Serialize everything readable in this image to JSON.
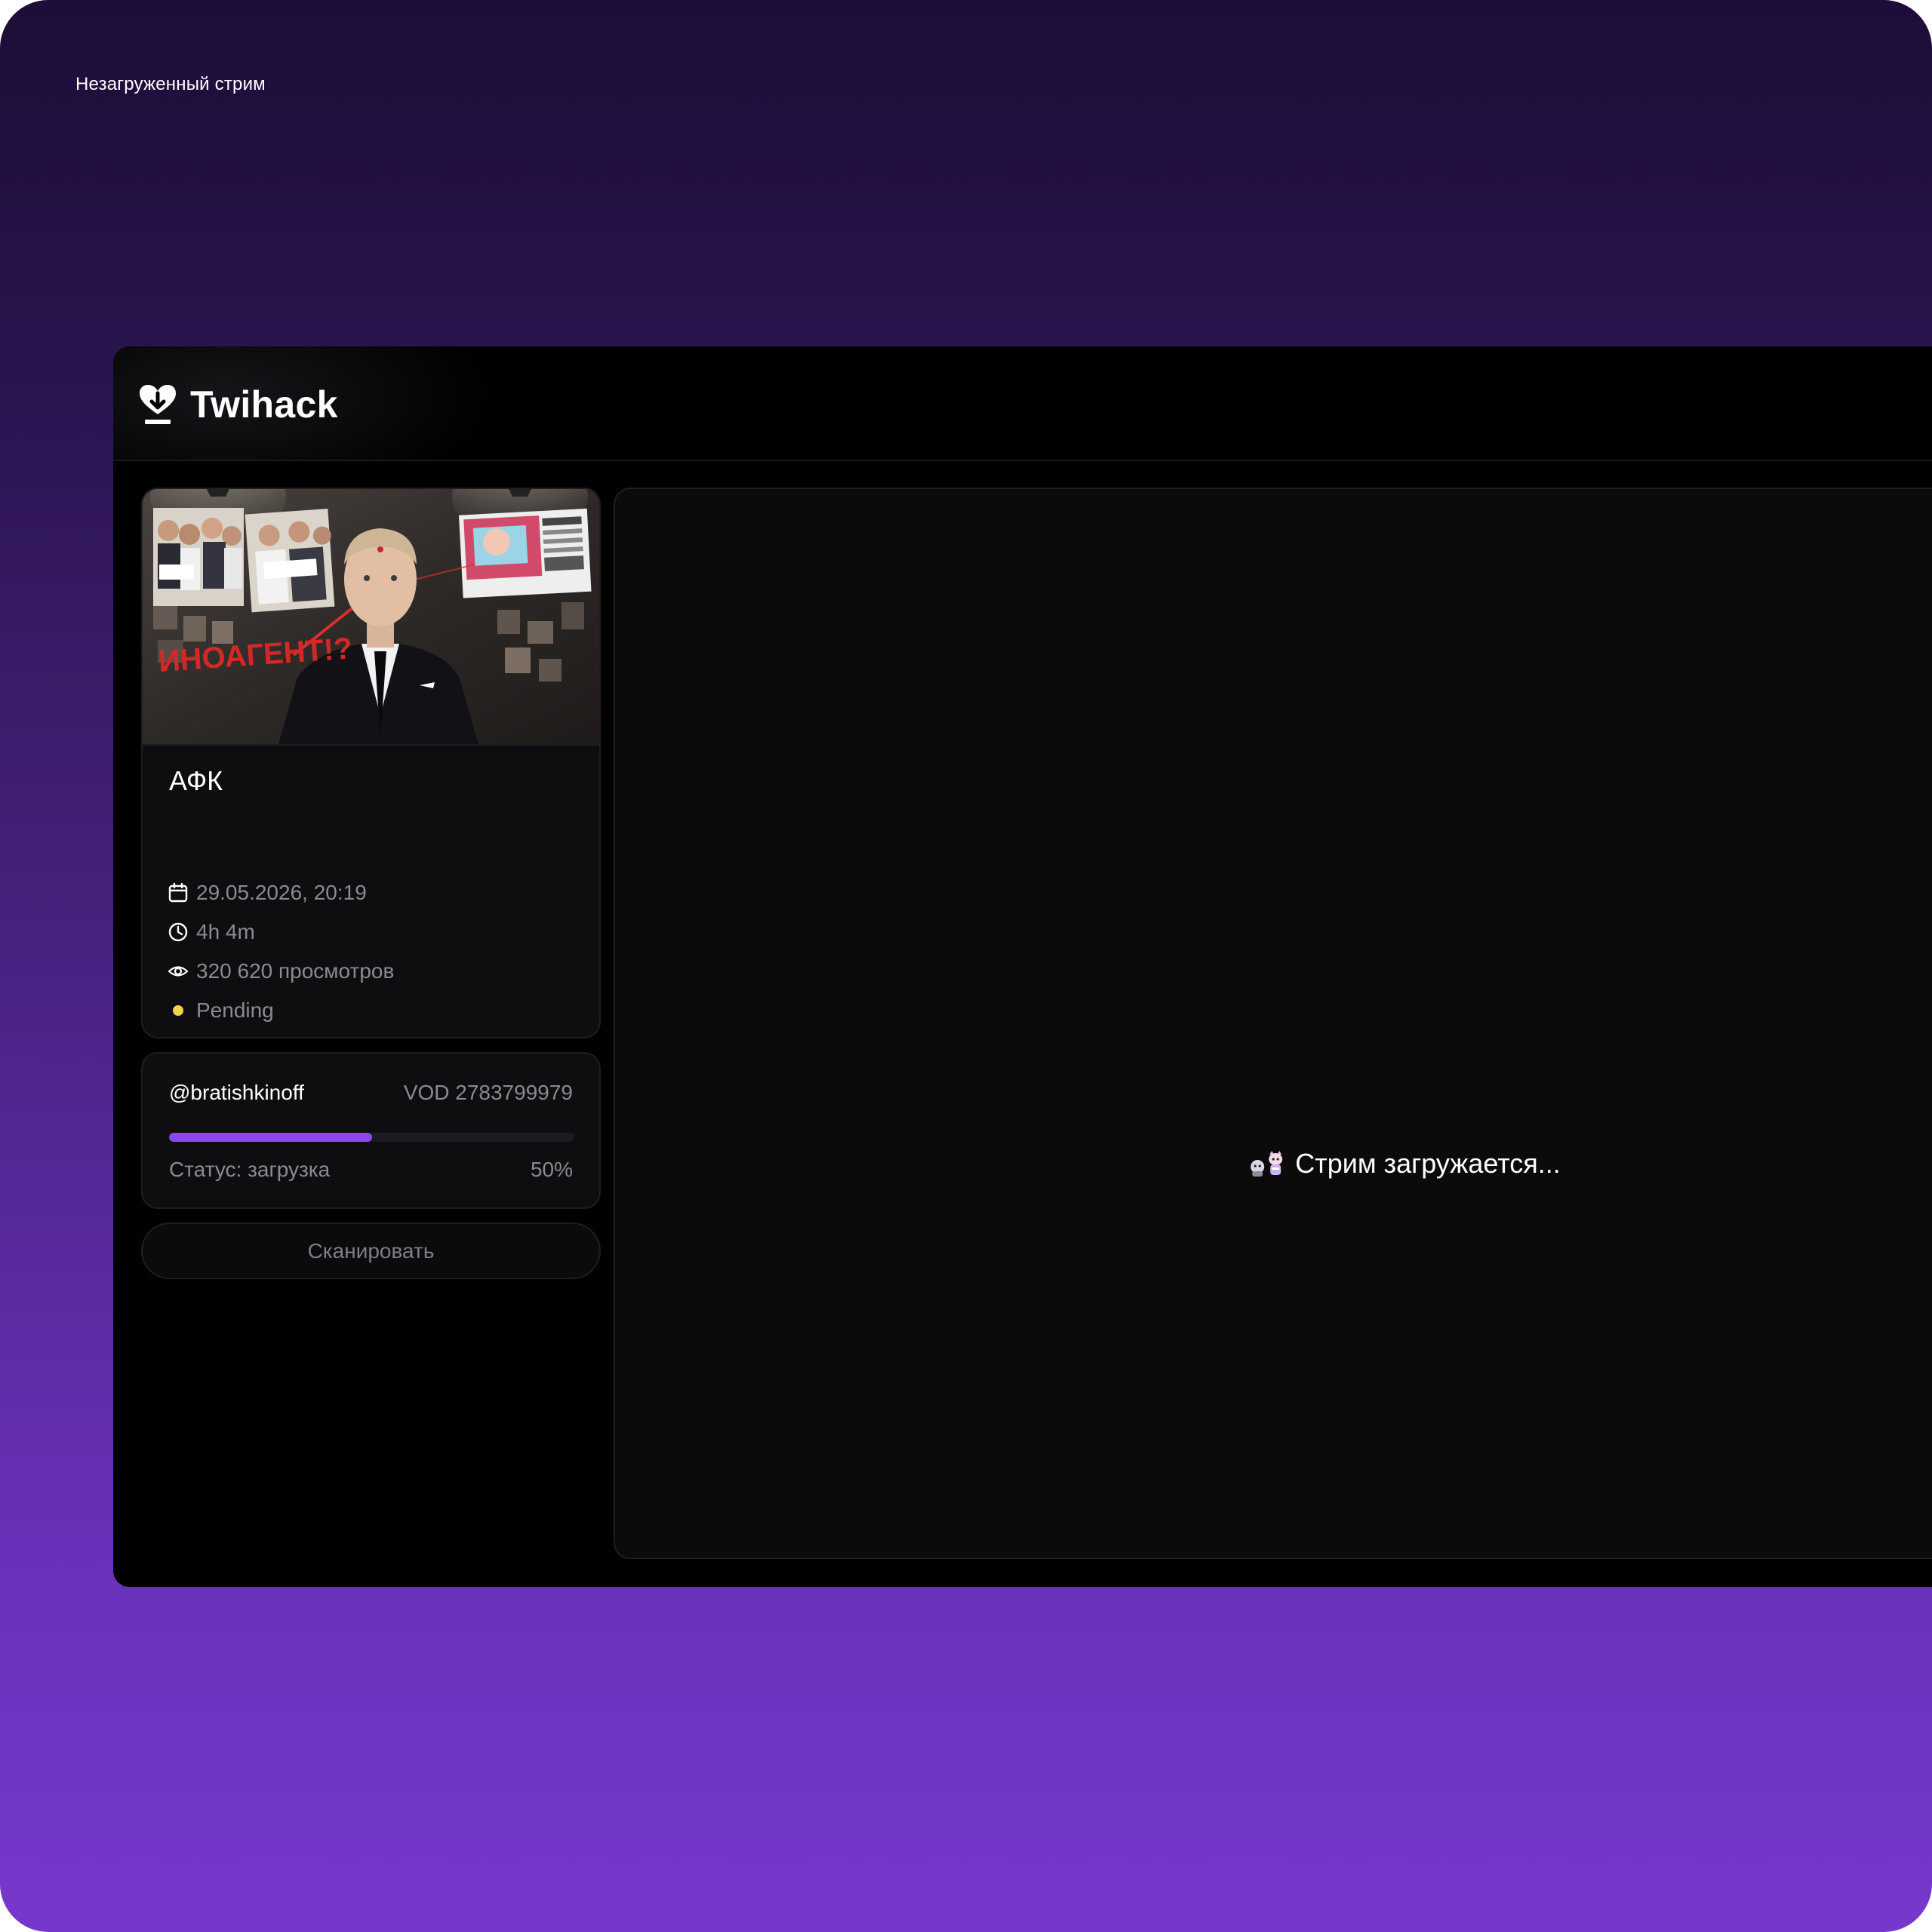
{
  "frame": {
    "label": "Незагруженный стрим"
  },
  "app": {
    "name": "Twihack",
    "logo_icon": "heart-download-icon"
  },
  "stream": {
    "title": "АФК",
    "thumbnail_text": "ИНОАГЕНТ!?",
    "date": "29.05.2026, 20:19",
    "duration": "4h 4m",
    "views": "320 620 просмотров",
    "status": "Pending",
    "status_color": "#f1d24b",
    "icons": {
      "date": "calendar-icon",
      "duration": "clock-icon",
      "views": "eye-icon",
      "status": "status-dot"
    }
  },
  "job": {
    "username": "@bratishkinoff",
    "vod_label": "VOD 2783799979",
    "status_label": "Статус: загрузка",
    "progress_percent": 50,
    "progress_text": "50%",
    "progress_color": "#8a47f0"
  },
  "actions": {
    "scan_label": "Сканировать"
  },
  "player": {
    "loading_text": "Стрим загружается..."
  }
}
